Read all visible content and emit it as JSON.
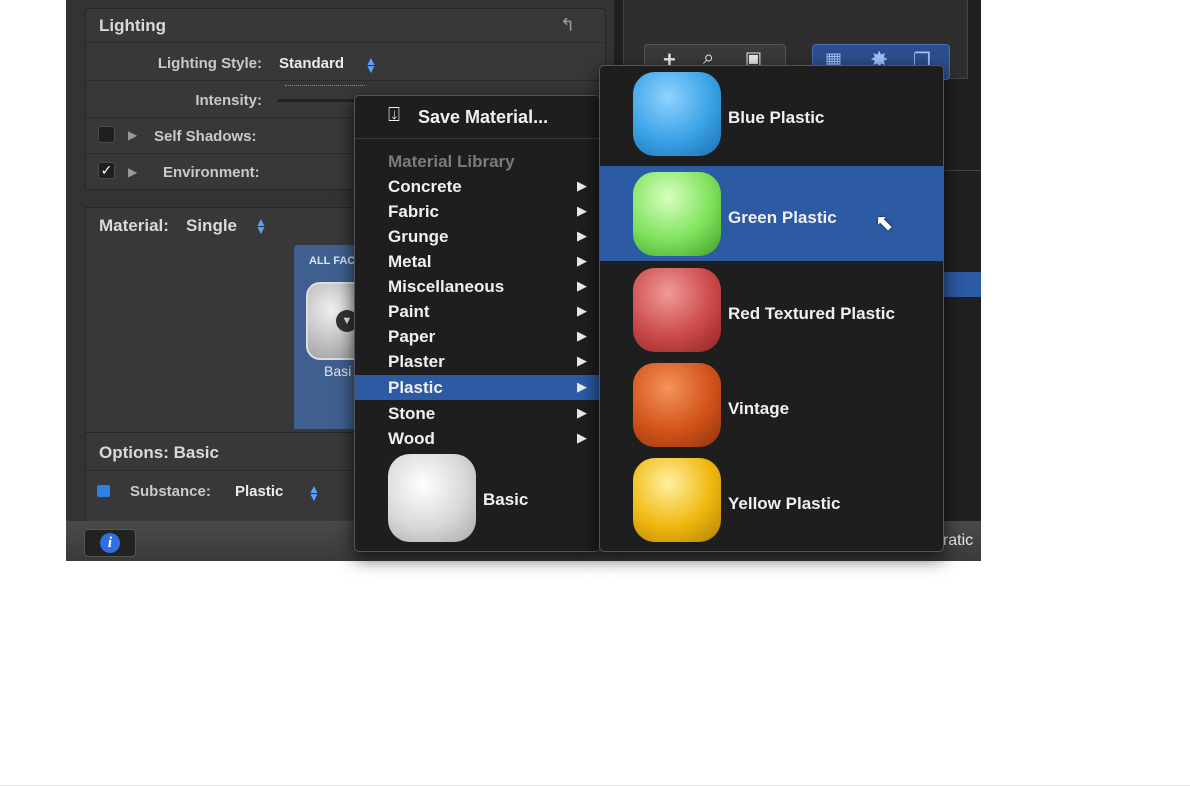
{
  "lighting": {
    "title": "Lighting",
    "style_label": "Lighting Style:",
    "style_value": "Standard",
    "intensity_label": "Intensity:",
    "self_shadows_label": "Self Shadows:",
    "environment_label": "Environment:"
  },
  "material": {
    "label": "Material:",
    "value": "Single",
    "faces_label": "ALL FAC",
    "thumb_label": "Basi"
  },
  "options": {
    "title": "Options: Basic",
    "substance_label": "Substance:",
    "substance_value": "Plastic"
  },
  "bottom": {
    "info_label": "i",
    "right_text": "uratic"
  },
  "menu": {
    "save_label": "Save Material...",
    "library_header": "Material Library",
    "items": [
      {
        "label": "Concrete"
      },
      {
        "label": "Fabric"
      },
      {
        "label": "Grunge"
      },
      {
        "label": "Metal"
      },
      {
        "label": "Miscellaneous"
      },
      {
        "label": "Paint"
      },
      {
        "label": "Paper"
      },
      {
        "label": "Plaster"
      },
      {
        "label": "Plastic"
      },
      {
        "label": "Stone"
      },
      {
        "label": "Wood"
      }
    ],
    "selected": "Plastic",
    "basic_label": "Basic"
  },
  "submenu": {
    "items": [
      {
        "label": "Blue Plastic",
        "color": "#3aa2e6"
      },
      {
        "label": "Green Plastic",
        "color": "#7fe25c"
      },
      {
        "label": "Red Textured Plastic",
        "color": "#cc4a4a"
      },
      {
        "label": "Vintage",
        "color": "#d2531a"
      },
      {
        "label": "Yellow Plastic",
        "color": "#f0b80e"
      }
    ],
    "selected": "Green Plastic"
  },
  "colors": {
    "accent": "#2c5aa3",
    "stepper": "#5aa0ff"
  }
}
